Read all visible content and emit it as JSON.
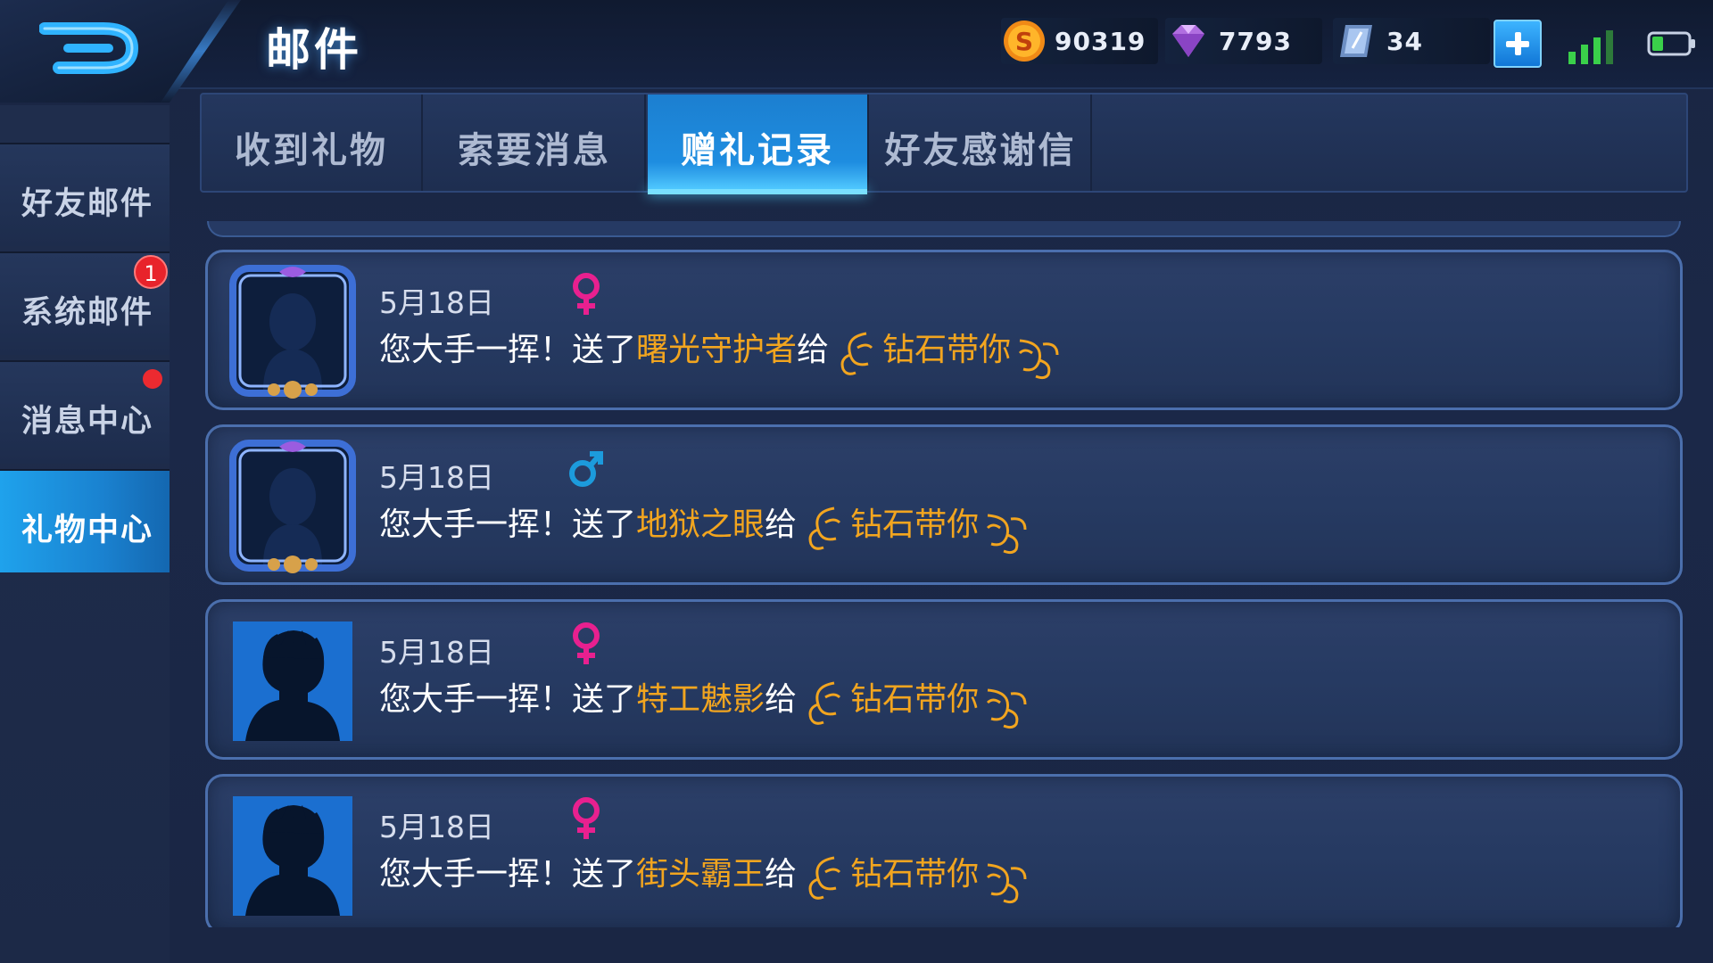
{
  "header": {
    "title": "邮件",
    "currencies": [
      {
        "name": "gold-coin",
        "value": "90319"
      },
      {
        "name": "diamond",
        "value": "7793"
      },
      {
        "name": "voucher",
        "value": "34"
      }
    ]
  },
  "sidebar": {
    "items": [
      {
        "label": "好友邮件",
        "active": false
      },
      {
        "label": "系统邮件",
        "badge": "1",
        "active": false
      },
      {
        "label": "消息中心",
        "dot": true,
        "active": false
      },
      {
        "label": "礼物中心",
        "active": true
      }
    ]
  },
  "tabs": [
    {
      "label": "收到礼物",
      "active": false
    },
    {
      "label": "索要消息",
      "active": false
    },
    {
      "label": "赠礼记录",
      "active": true
    },
    {
      "label": "好友感谢信",
      "active": false
    }
  ],
  "records": [
    {
      "date": "5月18日",
      "gender": "female",
      "lead": "您大手一挥！",
      "sent": "送了",
      "gift": "曙光守护者",
      "to": "给",
      "recipient": "钻石带你",
      "avatar": "framed-silhouette"
    },
    {
      "date": "5月18日",
      "gender": "male",
      "lead": "您大手一挥！",
      "sent": "送了",
      "gift": "地狱之眼",
      "to": "给",
      "recipient": "钻石带你",
      "avatar": "framed-silhouette"
    },
    {
      "date": "5月18日",
      "gender": "female",
      "lead": "您大手一挥！",
      "sent": "送了",
      "gift": "特工魅影",
      "to": "给",
      "recipient": "钻石带你",
      "avatar": "silhouette"
    },
    {
      "date": "5月18日",
      "gender": "female",
      "lead": "您大手一挥！",
      "sent": "送了",
      "gift": "街头霸王",
      "to": "给",
      "recipient": "钻石带你",
      "avatar": "silhouette"
    }
  ],
  "colors": {
    "accent": "#1fa2ec",
    "gift_text": "#f2a51f",
    "female": "#e8208f",
    "male": "#1c9bdc",
    "badge": "#e8232b"
  }
}
